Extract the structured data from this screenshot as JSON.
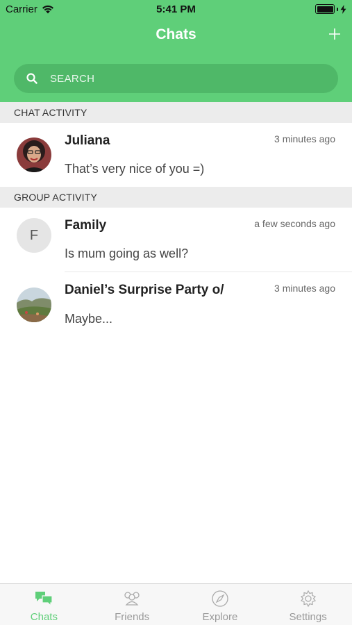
{
  "status_bar": {
    "carrier": "Carrier",
    "time": "5:41 PM"
  },
  "nav": {
    "title": "Chats",
    "add_label": "+"
  },
  "search": {
    "placeholder": "SEARCH"
  },
  "sections": {
    "chat_activity": "CHAT ACTIVITY",
    "group_activity": "GROUP ACTIVITY"
  },
  "chats": [
    {
      "name": "Juliana",
      "time": "3 minutes ago",
      "message": "That’s very nice of you =)"
    }
  ],
  "groups": [
    {
      "initial": "F",
      "name": "Family",
      "time": "a few seconds ago",
      "message": "Is mum going as well?"
    },
    {
      "name": "Daniel’s Surprise Party o/",
      "time": "3 minutes ago",
      "message": "Maybe..."
    }
  ],
  "tabs": [
    {
      "label": "Chats",
      "icon": "chat-bubbles-icon",
      "active": true
    },
    {
      "label": "Friends",
      "icon": "friends-icon",
      "active": false
    },
    {
      "label": "Explore",
      "icon": "compass-icon",
      "active": false
    },
    {
      "label": "Settings",
      "icon": "gear-icon",
      "active": false
    }
  ],
  "colors": {
    "accent": "#5fcf79",
    "search_bg": "#4fb868",
    "section_bg": "#ececec",
    "inactive_tab": "#999999"
  }
}
